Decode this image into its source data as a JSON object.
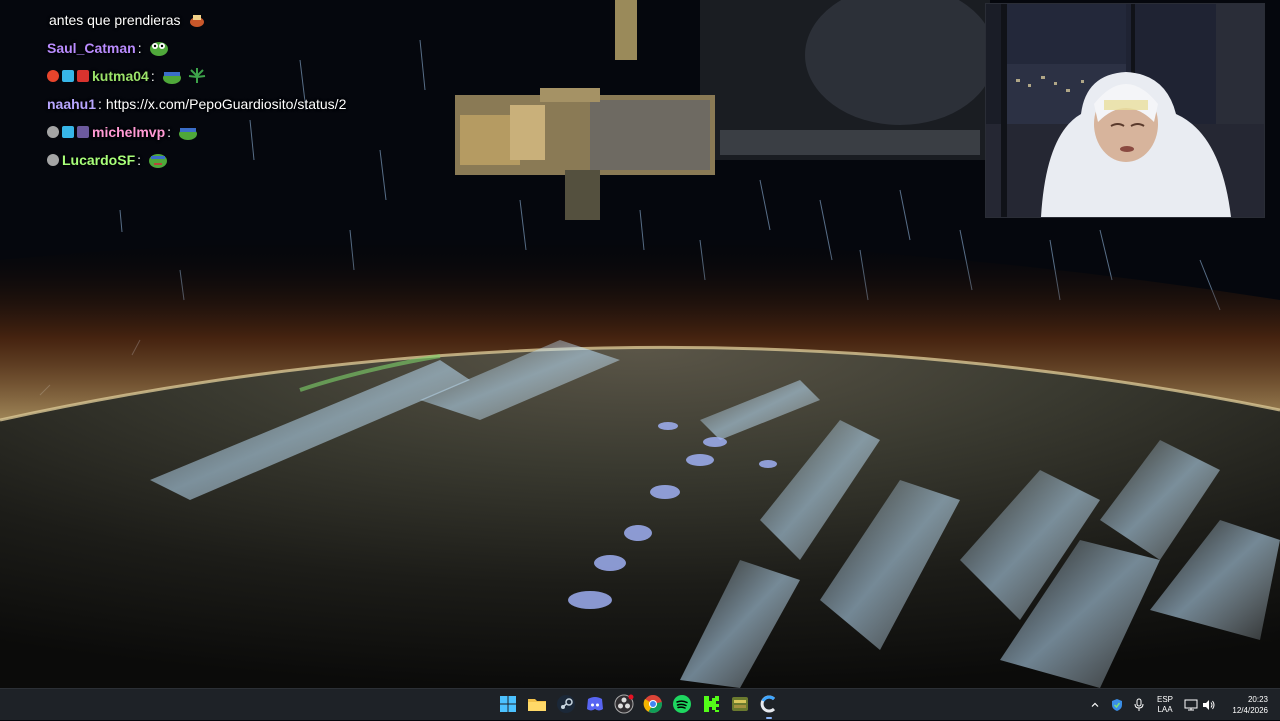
{
  "chat": {
    "lines": [
      {
        "user": "",
        "message": "antes que prendieras",
        "user_color": "#ffffff"
      },
      {
        "user": "Saul_Catman",
        "message": "",
        "user_color": "#b98cff"
      },
      {
        "user": "kutma04",
        "message": "",
        "user_color": "#9be36a"
      },
      {
        "user": "naahu1",
        "message": "https://x.com/PepoGuardiosito/status/2",
        "user_color": "#b7a6ff"
      },
      {
        "user": "michelmvp",
        "message": "",
        "user_color": "#ff9ad5"
      },
      {
        "user": "LucardoSF",
        "message": "",
        "user_color": "#a8ff7a"
      }
    ],
    "separator": ":"
  },
  "taskbar": {
    "apps": [
      {
        "name": "start-icon"
      },
      {
        "name": "file-explorer-icon"
      },
      {
        "name": "steam-icon"
      },
      {
        "name": "discord-icon"
      },
      {
        "name": "obs-icon"
      },
      {
        "name": "chrome-icon"
      },
      {
        "name": "spotify-icon"
      },
      {
        "name": "kick-icon"
      },
      {
        "name": "game-app-icon"
      },
      {
        "name": "browser-c-icon"
      }
    ],
    "tray": {
      "lang_line1": "ESP",
      "lang_line2": "LAA",
      "time": "20:23",
      "date": "12/4/2026"
    }
  },
  "colors": {
    "taskbar_bg": "#1e2227",
    "accent": "#8ab4f8"
  }
}
